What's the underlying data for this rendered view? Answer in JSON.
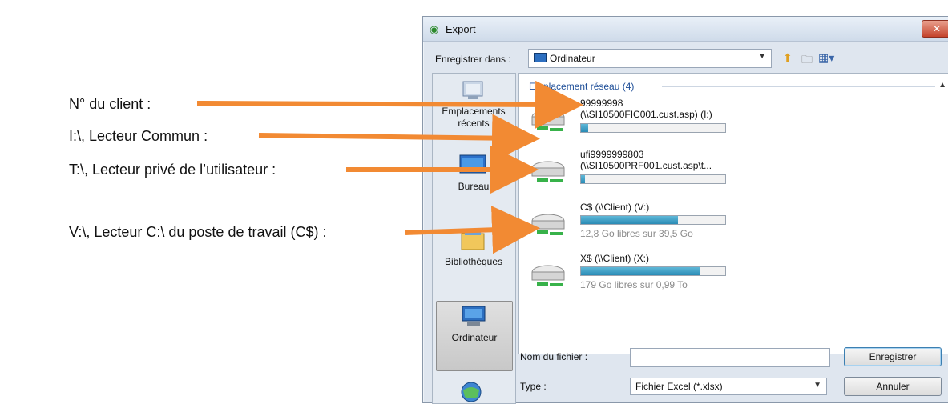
{
  "annotations": [
    {
      "text": "N° du client :"
    },
    {
      "text": "I:\\, Lecteur Commun :"
    },
    {
      "text": "T:\\, Lecteur privé de l’utilisateur :"
    },
    {
      "text": "V:\\, Lecteur C:\\ du poste de travail (C$) :"
    }
  ],
  "dialog": {
    "title": "Export",
    "close_label": "✕",
    "save_in_label": "Enregistrer dans :",
    "location": "Ordinateur",
    "places": [
      {
        "label": "Emplacements récents"
      },
      {
        "label": "Bureau"
      },
      {
        "label": "Bibliothèques"
      },
      {
        "label": "Ordinateur"
      }
    ],
    "group_title": "Emplacement réseau (4)",
    "drives": [
      {
        "name": "99999998",
        "path": "(\\\\SI10500FIC001.cust.asp) (I:)",
        "used": 0.05,
        "free": ""
      },
      {
        "name": "ufi9999999803",
        "path": "(\\\\SI10500PRF001.cust.asp\\t...",
        "used": 0.03,
        "free": ""
      },
      {
        "name": "C$ (\\\\Client) (V:)",
        "path": "",
        "used": 0.67,
        "free": "12,8 Go libres sur 39,5 Go"
      },
      {
        "name": "X$ (\\\\Client) (X:)",
        "path": "",
        "used": 0.82,
        "free": "179 Go libres sur 0,99 To"
      }
    ],
    "filename_label": "Nom du fichier :",
    "filename_value": "",
    "type_label": "Type :",
    "type_value": "Fichier Excel (*.xlsx)",
    "save_button": "Enregistrer",
    "cancel_button": "Annuler"
  },
  "colors": {
    "arrow": "#f28a33",
    "accent": "#1e4e98",
    "bar_fill": "#2a8bb5"
  },
  "icons": [
    "export-icon",
    "computer-icon",
    "up-folder-icon",
    "new-folder-icon",
    "views-icon",
    "network-drive-icon",
    "recent-places-icon",
    "desktop-icon",
    "libraries-icon",
    "network-icon"
  ]
}
